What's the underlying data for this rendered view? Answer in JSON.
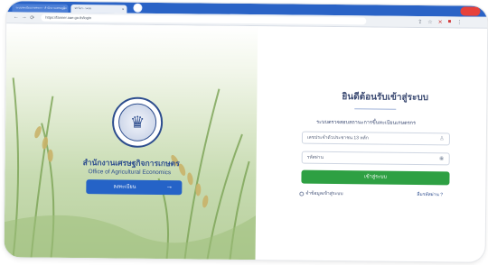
{
  "browser": {
    "tabs": [
      {
        "title": "ระบบทะเบียนเกษตรกร - สำนักงานเศรษฐกิจ",
        "active": false
      },
      {
        "title": "ฟาร์มฯ - ระบบ",
        "active": true
      }
    ],
    "url": "https://farmer.oae.go.th/login"
  },
  "hero": {
    "org_name_th": "สำนักงานเศรษฐกิจการเกษตร",
    "org_name_en": "Office of Agricultural Economics",
    "register_label": "ลงทะเบียน",
    "register_arrow": "→"
  },
  "login": {
    "welcome": "ยินดีต้อนรับเข้าสู่ระบบ",
    "subtitle": "ระบบตรวจสอบสถานะการขึ้นทะเบียนเกษตรกร",
    "username_placeholder": "เลขประจำตัวประชาชน 13 หลัก",
    "password_placeholder": "รหัสผ่าน",
    "submit_label": "เข้าสู่ระบบ",
    "remember_label": "จำข้อมูลเข้าสู่ระบบ",
    "forgot_label": "ลืมรหัสผ่าน ?"
  },
  "icons": {
    "user_field": "user-icon",
    "password_field": "eye-icon"
  },
  "colors": {
    "brand_blue": "#2563c7",
    "login_green": "#2ea043",
    "text_navy": "#3b4a72"
  }
}
